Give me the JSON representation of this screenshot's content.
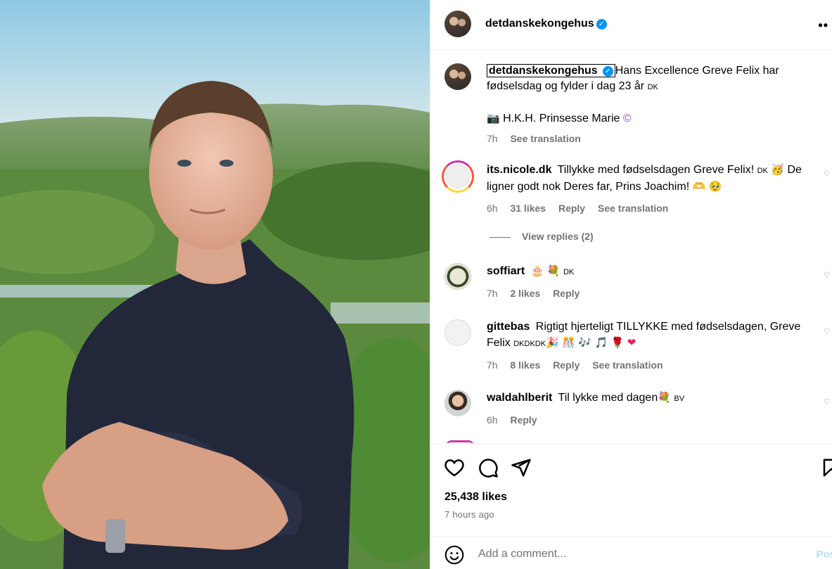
{
  "post": {
    "author": "detdanskekongehus",
    "caption_text": "Hans Excellence Greve Felix har fødselsdag og fylder i dag 23 år",
    "caption_flag": "DK",
    "caption_credit": "H.K.H. Prinsesse Marie",
    "caption_credit_icon": "camera-icon",
    "caption_time": "7h",
    "caption_translate": "See translation",
    "likes": "25,438 likes",
    "posted_ago": "7 hours ago"
  },
  "comments": [
    {
      "user": "its.nicole.dk",
      "text": "Tillykke med fødselsdagen Greve Felix!",
      "flag": "DK",
      "text2": "De ligner godt nok Deres far, Prins Joachim!",
      "time": "6h",
      "likes": "31 likes",
      "reply": "Reply",
      "translate": "See translation",
      "view_replies": "View replies (2)"
    },
    {
      "user": "soffiart",
      "flag": "DK",
      "time": "7h",
      "likes": "2 likes",
      "reply": "Reply"
    },
    {
      "user": "gittebas",
      "text": "Rigtigt hjerteligt TILLYKKE med fødselsdagen, Greve Felix",
      "flag": "DKDKDK",
      "time": "7h",
      "likes": "8 likes",
      "reply": "Reply",
      "translate": "See translation"
    },
    {
      "user": "waldahlberit",
      "text": "Til lykke med dagen",
      "flag": "BV",
      "time": "6h",
      "reply": "Reply"
    }
  ],
  "add_comment": {
    "placeholder": "Add a comment...",
    "post_label": "Pos"
  },
  "icons": {
    "like": "heart-icon",
    "comment": "comment-icon",
    "share": "share-icon",
    "save": "bookmark-icon",
    "emoji": "smiley-icon",
    "more": "more-options-icon",
    "verified": "verified-badge-icon"
  },
  "colors": {
    "verified": "#0095f6",
    "muted": "#737373",
    "post_button": "#b2dffc"
  }
}
